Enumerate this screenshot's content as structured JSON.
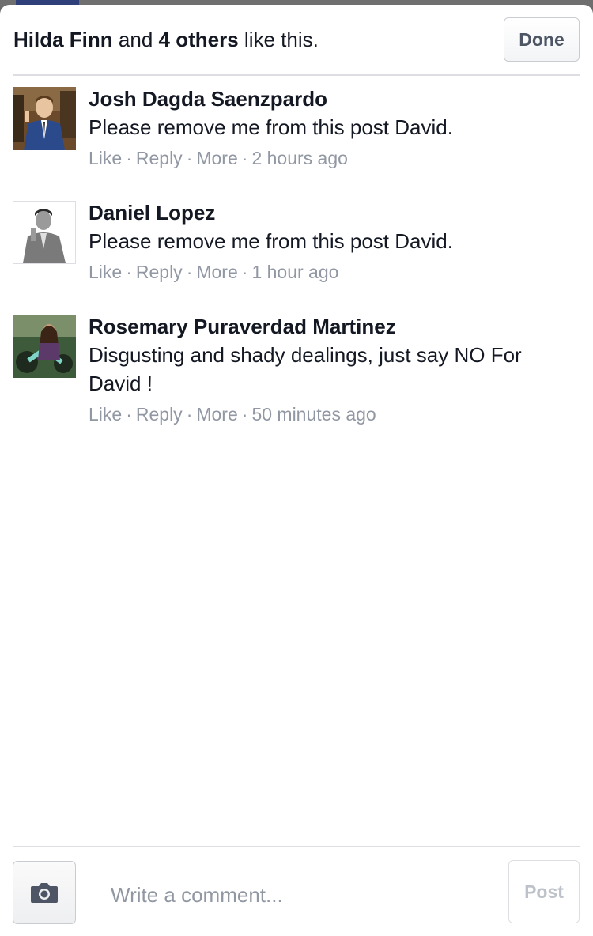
{
  "header": {
    "likes_name": "Hilda Finn",
    "likes_and": "and",
    "likes_others": "4 others",
    "likes_suffix": "like this.",
    "done_label": "Done"
  },
  "comments": [
    {
      "author": "Josh Dagda Saenzpardo",
      "text": "Please remove me from this post David.",
      "like": "Like",
      "reply": "Reply",
      "more": "More",
      "time": "2 hours ago"
    },
    {
      "author": "Daniel Lopez",
      "text": "Please remove me from this post David.",
      "like": "Like",
      "reply": "Reply",
      "more": "More",
      "time": "1 hour ago"
    },
    {
      "author": "Rosemary Puraverdad Martinez",
      "text": "Disgusting and shady dealings, just say NO For David !",
      "like": "Like",
      "reply": "Reply",
      "more": "More",
      "time": "50 minutes ago"
    }
  ],
  "composer": {
    "camera_icon": "camera-icon",
    "placeholder": "Write a comment...",
    "post_label": "Post"
  },
  "colors": {
    "text": "#141823",
    "meta": "#9197a3",
    "button_text": "#4e5665",
    "disabled": "#bdc1c9"
  }
}
